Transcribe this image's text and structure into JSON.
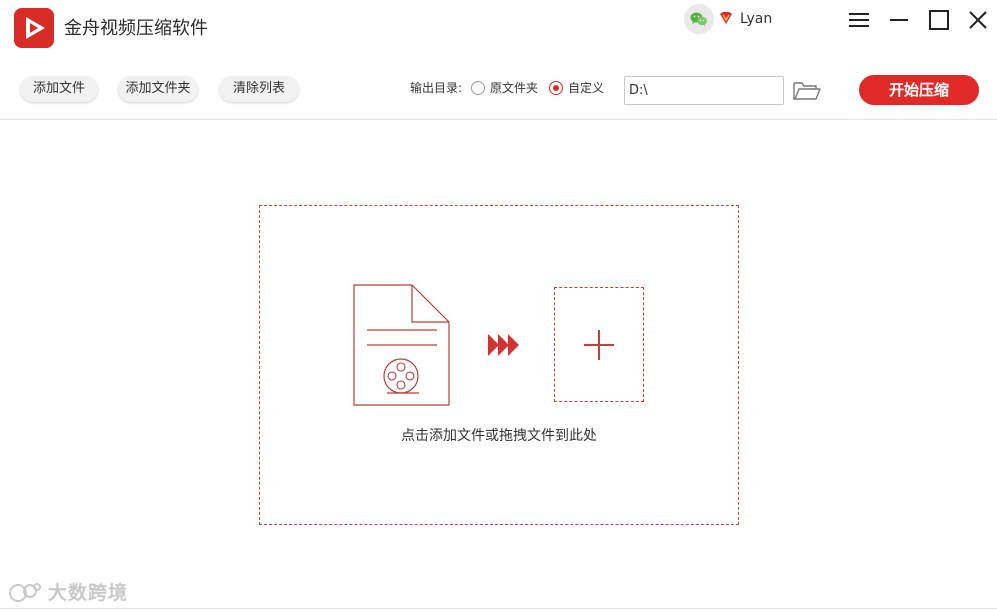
{
  "app": {
    "title": "金舟视频压缩软件",
    "accent_color": "#e02a27",
    "logo_icon": "play-icon"
  },
  "user": {
    "name": "Lyan",
    "wechat_icon": "wechat-icon",
    "vip_icon": "vip-badge-icon"
  },
  "window_controls": {
    "menu_icon": "menu-icon",
    "minimize_icon": "minimize-icon",
    "maximize_icon": "maximize-icon",
    "close_icon": "close-icon"
  },
  "toolbar": {
    "add_file_label": "添加文件",
    "add_folder_label": "添加文件夹",
    "clear_list_label": "清除列表",
    "output_dir_label": "输出目录:",
    "output_options": [
      {
        "label": "原文件夹",
        "selected": false
      },
      {
        "label": "自定义",
        "selected": true
      }
    ],
    "output_path": "D:\\",
    "browse_icon": "folder-open-icon",
    "start_label": "开始压缩"
  },
  "dropzone": {
    "hint": "点击添加文件或拖拽文件到此处",
    "file_icon": "video-file-icon",
    "arrow_icon": "triple-arrow-icon",
    "add_icon": "plus-icon"
  },
  "watermark": {
    "text": "大数跨境"
  }
}
